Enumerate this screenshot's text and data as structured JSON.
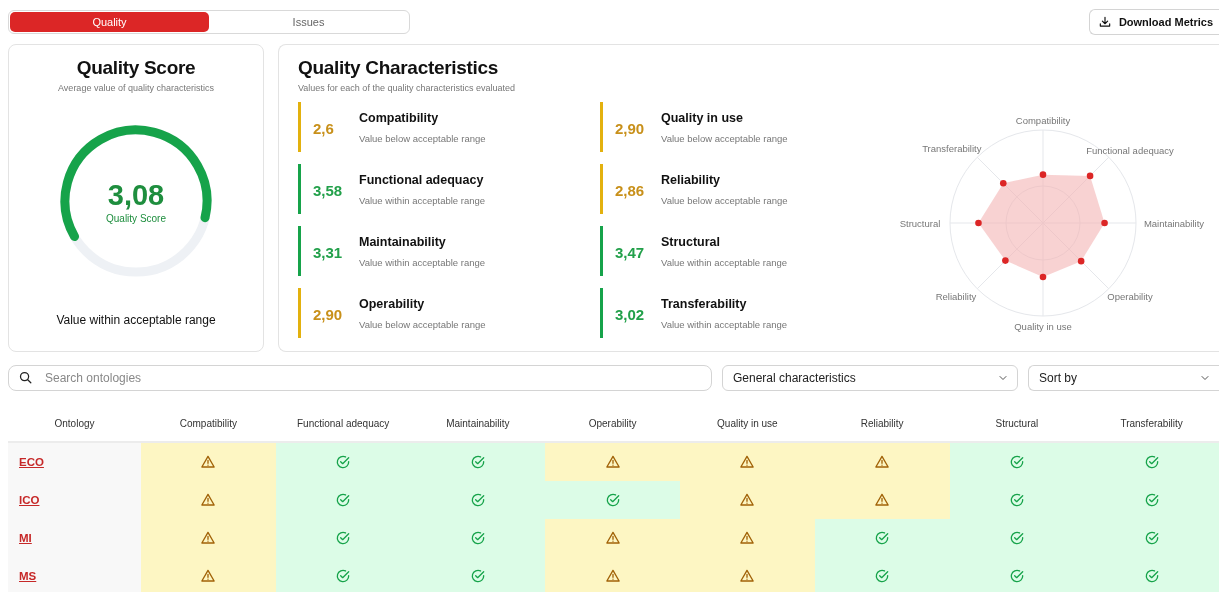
{
  "tabs": [
    {
      "label": "Quality",
      "selected": true
    },
    {
      "label": "Issues",
      "selected": false
    }
  ],
  "download_button": {
    "label": "Download Metrics"
  },
  "quality_score": {
    "title": "Quality Score",
    "subtitle": "Average value of quality characteristics",
    "value": "3,08",
    "value_label": "Quality Score",
    "verdict": "Value within acceptable range"
  },
  "quality_characteristics": {
    "title": "Quality Characteristics",
    "subtitle": "Values for each of the quality characteristics evaluated",
    "items": [
      {
        "value": "2,6",
        "name": "Compatibility",
        "status": "Value below acceptable range",
        "kind": "below"
      },
      {
        "value": "3,58",
        "name": "Functional adequacy",
        "status": "Value within acceptable range",
        "kind": "within"
      },
      {
        "value": "3,31",
        "name": "Maintainability",
        "status": "Value within acceptable range",
        "kind": "within"
      },
      {
        "value": "2,90",
        "name": "Operability",
        "status": "Value below acceptable range",
        "kind": "below"
      },
      {
        "value": "2,90",
        "name": "Quality in use",
        "status": "Value below acceptable range",
        "kind": "below"
      },
      {
        "value": "2,86",
        "name": "Reliability",
        "status": "Value below acceptable range",
        "kind": "below"
      },
      {
        "value": "3,47",
        "name": "Structural",
        "status": "Value within acceptable range",
        "kind": "within"
      },
      {
        "value": "3,02",
        "name": "Transferability",
        "status": "Value within acceptable range",
        "kind": "within"
      }
    ],
    "radar_labels": [
      "Compatibility",
      "Functional adequacy",
      "Maintainability",
      "Operability",
      "Quality in use",
      "Reliability",
      "Structural",
      "Transferability"
    ]
  },
  "search": {
    "placeholder": "Search ontologies"
  },
  "filter_select": {
    "value": "General characteristics"
  },
  "sort_select": {
    "value": "Sort by"
  },
  "table": {
    "columns": [
      "Ontology",
      "Compatibility",
      "Functional adequacy",
      "Maintainability",
      "Operability",
      "Quality in use",
      "Reliability",
      "Structural",
      "Transferability"
    ],
    "rows": [
      {
        "ontology": "ECO",
        "cells": [
          {
            "kind": "warning"
          },
          {
            "kind": "ok"
          },
          {
            "kind": "ok"
          },
          {
            "kind": "warning"
          },
          {
            "kind": "warning"
          },
          {
            "kind": "warning"
          },
          {
            "kind": "ok"
          },
          {
            "kind": "ok"
          }
        ]
      },
      {
        "ontology": "ICO",
        "cells": [
          {
            "kind": "warning"
          },
          {
            "kind": "ok"
          },
          {
            "kind": "ok"
          },
          {
            "kind": "ok"
          },
          {
            "kind": "warning"
          },
          {
            "kind": "warning"
          },
          {
            "kind": "ok"
          },
          {
            "kind": "ok"
          }
        ]
      },
      {
        "ontology": "MI",
        "cells": [
          {
            "kind": "warning"
          },
          {
            "kind": "ok"
          },
          {
            "kind": "ok"
          },
          {
            "kind": "warning"
          },
          {
            "kind": "warning"
          },
          {
            "kind": "ok"
          },
          {
            "kind": "ok"
          },
          {
            "kind": "ok"
          }
        ]
      },
      {
        "ontology": "MS",
        "cells": [
          {
            "kind": "warning"
          },
          {
            "kind": "ok"
          },
          {
            "kind": "ok"
          },
          {
            "kind": "warning"
          },
          {
            "kind": "warning"
          },
          {
            "kind": "ok"
          },
          {
            "kind": "ok"
          },
          {
            "kind": "ok"
          }
        ]
      }
    ]
  }
}
